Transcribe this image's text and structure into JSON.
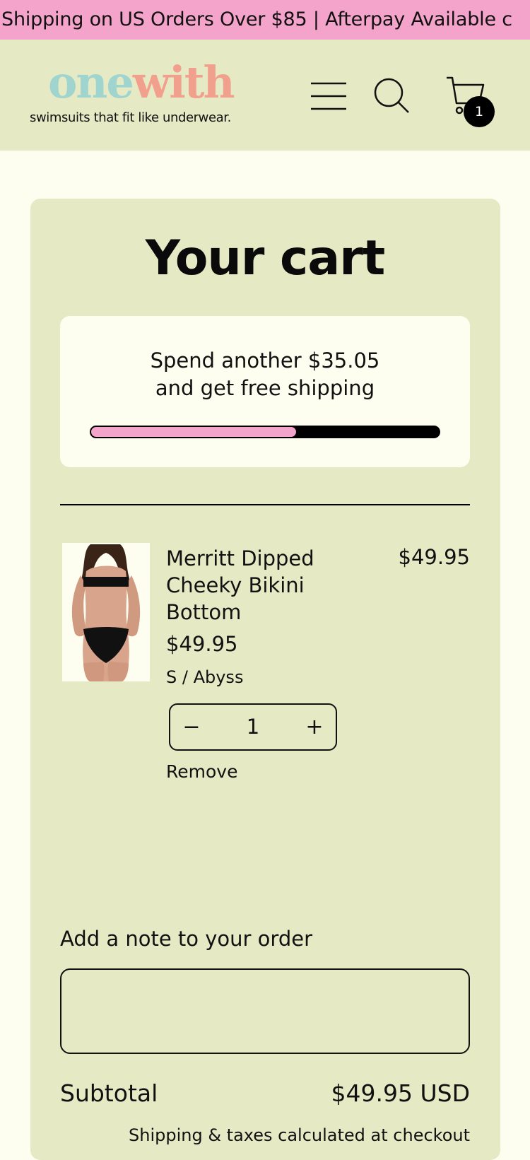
{
  "announcement": {
    "text": "Shipping on US Orders Over $85 | Afterpay Available c"
  },
  "header": {
    "logo": {
      "word_one": "one",
      "word_with": "with",
      "tagline": "swimsuits that fit like underwear."
    },
    "icons": {
      "menu": "hamburger-menu-icon",
      "search": "search-icon",
      "cart": "cart-icon"
    },
    "cart_count": "1"
  },
  "cart": {
    "title": "Your cart",
    "shipping": {
      "line1": "Spend another $35.05",
      "line2": "and get free shipping",
      "progress": 0.59
    },
    "item": {
      "name": "Merritt Dipped Cheeky Bikini Bottom",
      "line_total": "$49.95",
      "price": "$49.95",
      "variant": "S / Abyss",
      "quantity": "1",
      "minus_label": "−",
      "plus_label": "+",
      "remove_label": "Remove"
    },
    "note": {
      "label": "Add a note to your order",
      "value": ""
    },
    "subtotal": {
      "label": "Subtotal",
      "value": "$49.95 USD"
    },
    "tax_note": "Shipping & taxes calculated at checkout"
  },
  "colors": {
    "announcement_bg": "#f4a4cb",
    "header_bg": "#e6eac4",
    "page_bg": "#fefef0",
    "progress_fill": "#f4a4cb",
    "logo_one": "#9fd4cf",
    "logo_with": "#f1a08d"
  }
}
